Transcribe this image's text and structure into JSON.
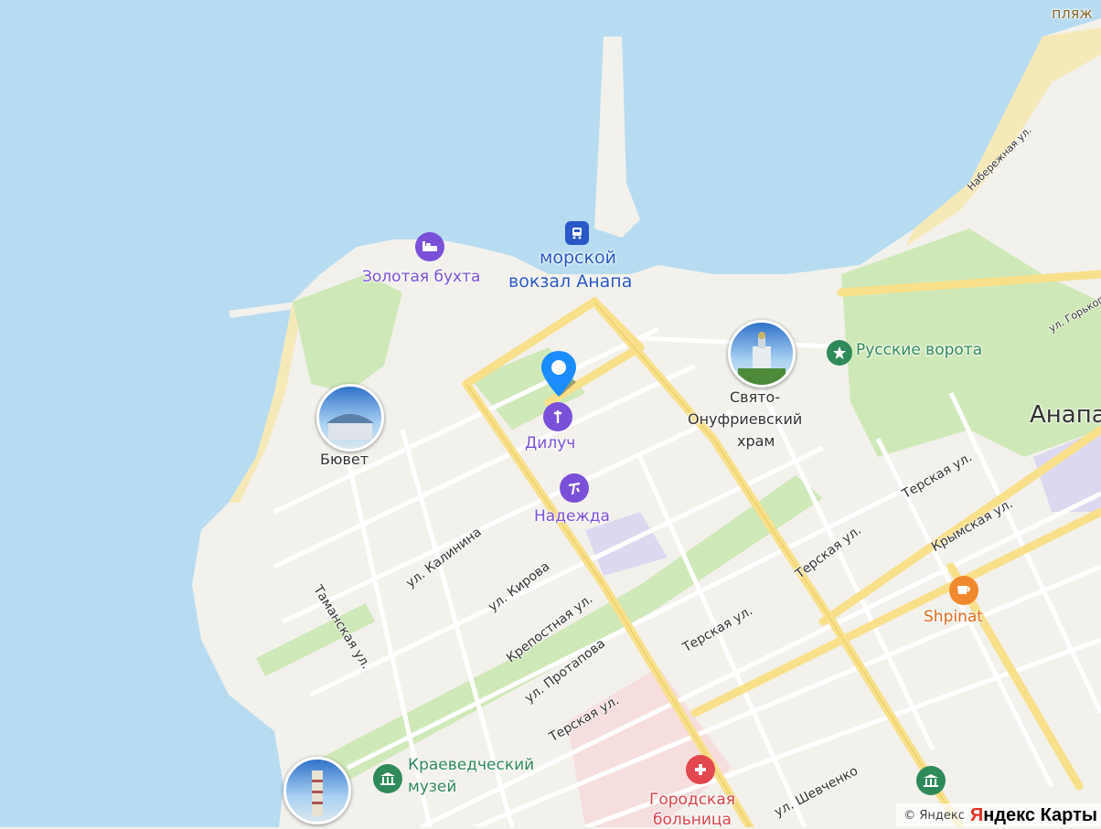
{
  "map": {
    "city_label": "Анапа",
    "beach_label": "пляж"
  },
  "pois": {
    "zolotaya": "Золотая бухта",
    "port_line1": "морской",
    "port_line2": "вокзал Анапа",
    "diluch": "Дилуч",
    "nadezhda": "Надежда",
    "buvet": "Бювет",
    "hram_line1": "Свято-",
    "hram_line2": "Онуфриевский",
    "hram_line3": "храм",
    "vorota": "Русские ворота",
    "shpinat": "Shpinat",
    "muzey_line1": "Краеведческий",
    "muzey_line2": "музей",
    "bolnica_line1": "Городская",
    "bolnica_line2": "больница"
  },
  "streets": {
    "kalinina": "ул. Калинина",
    "kirova": "ул. Кирова",
    "krepostnaya": "Крепостная ул.",
    "protapova": "ул. Протапова",
    "taman": "Таманская ул.",
    "terskaya": "Терская ул.",
    "krymskaya": "Крымская ул.",
    "shevchenko": "ул. Шевченко",
    "naberezhnaya": "Набережная ул.",
    "gorkogo": "ул. Горького"
  },
  "footer": {
    "copyright": "© Яндекс",
    "brand_red": "Я",
    "brand_rest": "ндекс Карты"
  },
  "colors": {
    "sea": "#b7dcf2",
    "land": "#f3f1ec",
    "park": "#cfe8b8",
    "road_major": "#f8e08a",
    "purple_poi": "#7a50d8",
    "green_poi": "#2f8a5a",
    "orange_poi": "#e06b1c",
    "red_poi": "#d8434b",
    "selected_pin": "#1a8cff"
  }
}
